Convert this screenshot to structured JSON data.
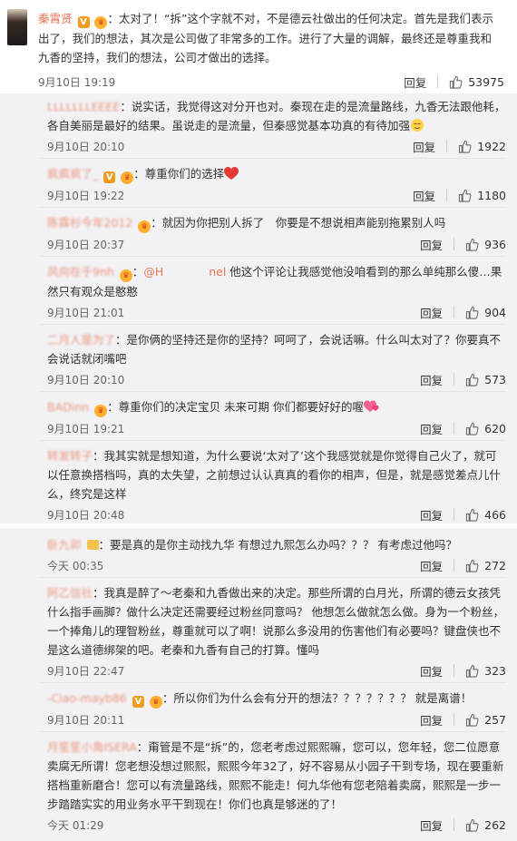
{
  "main_comment": {
    "author": "秦霄贤",
    "colon": "：",
    "text": "太对了！“拆”这个字就不对，不是德云社做出的任何决定。首先是我们表示出了，我们的想法，其次是公司做了非常多的工作。进行了大量的调解，最终还是尊重我和九香的坚持，我们的想法，公司才做出的选择。",
    "time": "9月10日 19:19",
    "reply_label": "回复",
    "likes": "53975"
  },
  "panel1_replies": [
    {
      "author": "LLLLLLLEEEE",
      "text": "：说实话，我觉得这对分开也对。秦现在走的是流量路线，九香无法跟他耗，各自美丽是最好的结果。虽说走的是流量，但秦感觉基本功真的有待加强",
      "time": "9月10日 20:10",
      "reply_label": "回复",
      "likes": "1922"
    },
    {
      "author": "疯疯疯了_",
      "text": "：尊重你们的选择",
      "time": "9月10日 19:22",
      "reply_label": "回复",
      "likes": "1180"
    },
    {
      "author": "陈霖杉今年2012",
      "text": "：就因为你把别人拆了　你要是不想说相声能别拖累别人吗",
      "time": "9月10日 20:37",
      "reply_label": "回复",
      "likes": "936"
    },
    {
      "author": "风向在于9nh",
      "mention": "@H　　　　nel",
      "text": " 他这个评论让我感觉他没咱看到的那么单纯那么傻…果然只有观众是憨憨",
      "time": "9月10日 21:01",
      "reply_label": "回复",
      "likes": "904"
    },
    {
      "author": "二月人是为了",
      "text": "：是你俩的坚持还是你的坚持？呵呵了，会说话嘛。什么叫太对了？你要真不会说话就闭嘴吧",
      "time": "9月10日 20:10",
      "reply_label": "回复",
      "likes": "573"
    },
    {
      "author": "BADinn",
      "text": "：尊重你们的决定宝贝 未来可期 你们都要好好的喔",
      "time": "9月10日 19:21",
      "reply_label": "回复",
      "likes": "620"
    },
    {
      "author": "转发转子",
      "text": "：我其实就是想知道，为什么要说‘太对了’这个我感觉就是你觉得自己火了，就可以任意换搭档吗，真的太失望，之前想过认认真真的看你的相声，但是，就是感觉差点儿什么，终究是这样",
      "time": "9月10日 20:48",
      "reply_label": "回复",
      "likes": "466"
    }
  ],
  "panel2_replies": [
    {
      "author": "卧九卯",
      "text": "：要是真的是你主动找九华 有想过九熙怎么办吗？？？ 有考虑过他吗？",
      "time": "今天 00:35",
      "reply_label": "回复",
      "likes": "272"
    },
    {
      "author": "阿乙信社",
      "text": "：我真是醉了～老秦和九香做出来的决定。那些所谓的白月光，所谓的德云女孩凭什么指手画脚？做什么决定还需要经过粉丝同意吗？ 他想怎么做就怎么做。身为一个粉丝，一个捧角儿的理智粉丝，尊重就可以了啊！说那么多没用的伤害他们有必要吗？键盘侠也不是这么道德绑架的吧。老秦和九香有自己的打算。懂吗",
      "time": "9月10日 22:47",
      "reply_label": "回复",
      "likes": "323"
    },
    {
      "author": "-Ciao-mayb86",
      "text": "：所以你们为什么会有分开的想法？？？？？？？ 就是离谱！",
      "time": "9月10日 20:11",
      "reply_label": "回复",
      "likes": "257"
    },
    {
      "author": "月笙笙小角ISERA",
      "text": "：甭管是不是“拆”的，您老考虑过熙熙嘛，您可以，您年轻，您二位愿意卖腐无所谓！您老想没想过熙熙，熙熙今年32了，好不容易从小园子干到专场，现在要重新搭档重新磨合！您可以有流量路线，熙熙不能走！何九华他有您老陪着卖腐，熙熙是一步一步踏踏实实的用业务水平干到现在！你们也真是够迷的了！",
      "time": "今天 01:29",
      "reply_label": "回复",
      "likes": "262"
    }
  ],
  "colors": {
    "username": "#eb7350",
    "panel_bg": "#f2f2f5",
    "text": "#333333",
    "time": "#666666"
  },
  "icons": {
    "like": "thumbs-up-icon",
    "verified": "v-badge-icon",
    "level": "fan-level-icon",
    "heart": "heart-emoji",
    "hearts": "beating-heart-emoji",
    "sweat": "sweat-smile-emoji"
  }
}
